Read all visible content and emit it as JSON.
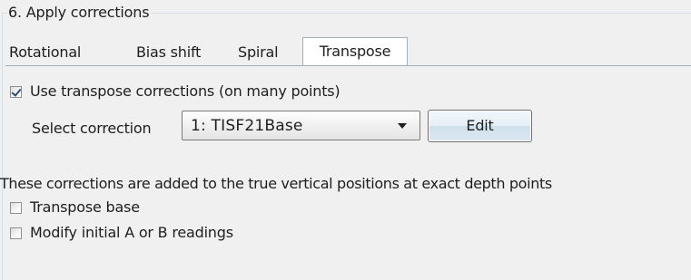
{
  "group": {
    "title": "6. Apply corrections"
  },
  "tabs": [
    {
      "label": "Rotational",
      "active": false
    },
    {
      "label": "Bias shift",
      "active": false
    },
    {
      "label": "Spiral",
      "active": false
    },
    {
      "label": "Transpose",
      "active": true
    }
  ],
  "transpose": {
    "use_checkbox": {
      "label": "Use transpose corrections (on many points)",
      "checked": true
    },
    "select_label": "Select correction",
    "select_value": "1: TISF21Base",
    "edit_button": "Edit",
    "note": "These corrections are added to the true vertical positions at exact depth points",
    "transpose_base": {
      "label": "Transpose base",
      "checked": false
    },
    "modify_readings": {
      "label": "Modify initial A or B readings",
      "checked": false
    }
  },
  "colors": {
    "panel_bg": "#f0f0f0",
    "tab_border": "#a3afba",
    "check_mark": "#2a4f7a",
    "button_face": "#dbe8f2"
  },
  "icons": {
    "dropdown": "chevron-down-icon",
    "check": "checkmark-icon"
  }
}
